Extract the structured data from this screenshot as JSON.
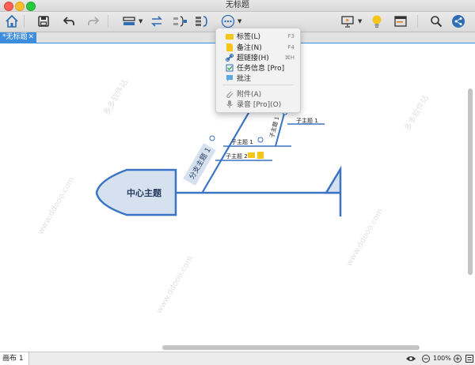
{
  "window": {
    "title": "无标题"
  },
  "colors": {
    "accent": "#3d8ddf",
    "fishbone": "#3b74c4",
    "topic_fill": "#d6e1f0",
    "close": "#fe5f57",
    "minimize": "#febc2e",
    "zoom": "#28c840"
  },
  "toolbar": {
    "icons": [
      "home-icon",
      "save-icon",
      "undo-icon",
      "redo-icon",
      "structure-icon",
      "relationship-icon",
      "summary-icon",
      "boundary-icon",
      "more-icon",
      "presentation-icon",
      "lightbulb-icon",
      "window-icon",
      "search-icon",
      "share-icon"
    ]
  },
  "tab": {
    "label": "*无标题",
    "close": "✕"
  },
  "mindmap": {
    "central": "中心主题",
    "branch": "分支主题 1",
    "subtopic1": "子主题 1",
    "subtopic2": "子主题 2",
    "subtopic_upper": "子主题 1",
    "diag_subtopic": "子主题 1"
  },
  "menu": {
    "items": [
      {
        "label": "标签(L)",
        "shortcut": "F3",
        "icon": "label-icon"
      },
      {
        "label": "备注(N)",
        "shortcut": "F4",
        "icon": "note-icon"
      },
      {
        "label": "超链接(H)",
        "shortcut": "⌘H",
        "icon": "link-icon"
      },
      {
        "label": "任务信息 [Pro]",
        "shortcut": "",
        "icon": "task-icon"
      },
      {
        "label": "批注",
        "shortcut": "",
        "icon": "comment-icon"
      },
      {
        "label": "附件(A)",
        "shortcut": "",
        "icon": "attachment-icon"
      },
      {
        "label": "录音 [Pro](O)",
        "shortcut": "",
        "icon": "microphone-icon"
      }
    ]
  },
  "watermark": {
    "text": "www.ddooo.com",
    "site": "多多软件站"
  },
  "statusbar": {
    "canvas_tab": "画布 1",
    "zoom": "100%"
  }
}
